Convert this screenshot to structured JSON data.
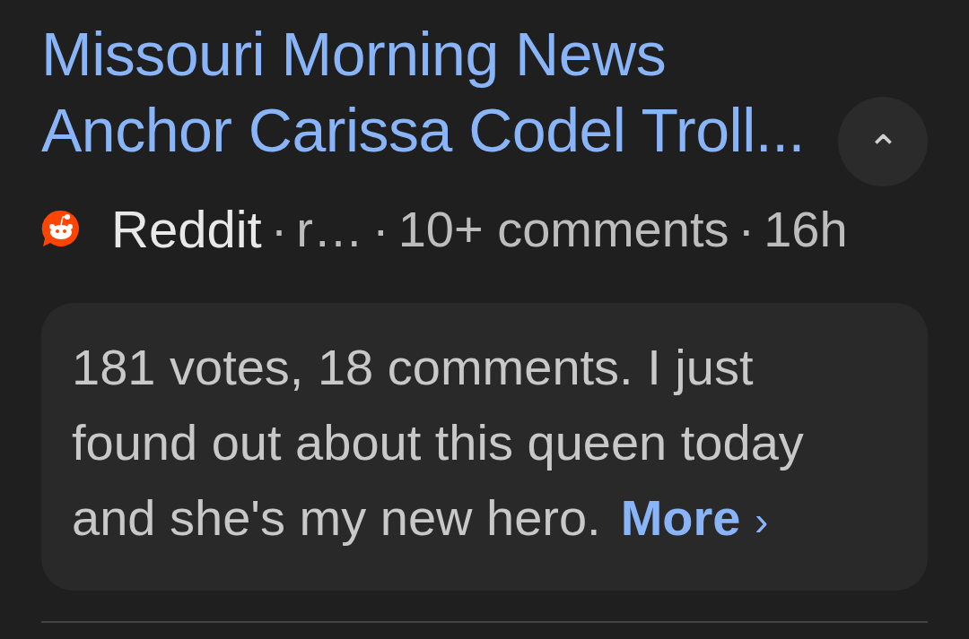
{
  "result": {
    "title": "Missouri Morning News\nAnchor Carissa Codel Troll...",
    "collapse_button": {
      "glyph": "⌃",
      "expanded": true
    },
    "source": "Reddit",
    "meta": [
      {
        "separator": "·",
        "text": "r…"
      },
      {
        "separator": "·",
        "text": "10+ comments"
      },
      {
        "separator": "·",
        "text": "16h"
      }
    ],
    "snippet": "181 votes, 18 comments. I just found out about this queen today and she's my new hero.",
    "more_link": {
      "label": "More",
      "glyph": "›"
    }
  }
}
